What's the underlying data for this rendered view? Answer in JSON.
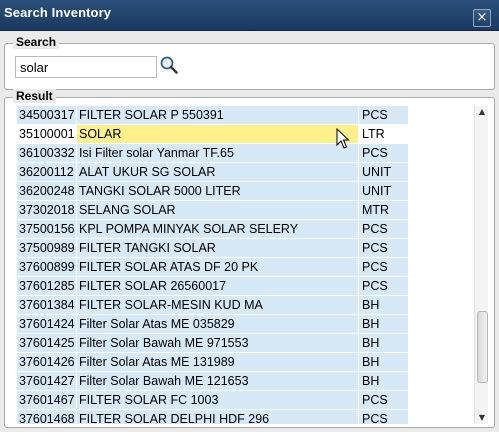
{
  "window": {
    "title": "Search Inventory",
    "close_label": "×"
  },
  "search": {
    "legend": "Search",
    "value": "solar"
  },
  "result": {
    "legend": "Result",
    "rows": [
      {
        "code": "34500317",
        "name": "FILTER SOLAR P 550391",
        "unit": "PCS"
      },
      {
        "code": "35100001",
        "name": "SOLAR",
        "unit": "LTR"
      },
      {
        "code": "36100332",
        "name": "Isi Filter solar Yanmar TF.65",
        "unit": "PCS"
      },
      {
        "code": "36200112",
        "name": "ALAT UKUR SG SOLAR",
        "unit": "UNIT"
      },
      {
        "code": "36200248",
        "name": "TANGKI SOLAR 5000 LITER",
        "unit": "UNIT"
      },
      {
        "code": "37302018",
        "name": "SELANG SOLAR",
        "unit": "MTR"
      },
      {
        "code": "37500156",
        "name": "KPL POMPA MINYAK SOLAR SELERY",
        "unit": "PCS"
      },
      {
        "code": "37500989",
        "name": "FILTER TANGKI SOLAR",
        "unit": "PCS"
      },
      {
        "code": "37600899",
        "name": "FILTER SOLAR ATAS DF 20 PK",
        "unit": "PCS"
      },
      {
        "code": "37601285",
        "name": "FILTER SOLAR 26560017",
        "unit": "PCS"
      },
      {
        "code": "37601384",
        "name": "FILTER SOLAR-MESIN KUD MA",
        "unit": "BH"
      },
      {
        "code": "37601424",
        "name": "Filter Solar Atas ME 035829",
        "unit": "BH"
      },
      {
        "code": "37601425",
        "name": "Filter Solar Bawah ME 971553",
        "unit": "BH"
      },
      {
        "code": "37601426",
        "name": "Filter Solar Atas ME 131989",
        "unit": "BH"
      },
      {
        "code": "37601427",
        "name": "Filter Solar Bawah ME 121653",
        "unit": "BH"
      },
      {
        "code": "37601467",
        "name": "FILTER SOLAR FC 1003",
        "unit": "PCS"
      },
      {
        "code": "37601468",
        "name": "FILTER SOLAR DELPHI HDF 296",
        "unit": "PCS"
      }
    ]
  },
  "scrollbar": {
    "up_glyph": "▲",
    "down_glyph": "▼"
  },
  "colors": {
    "titlebar": "#1f4470",
    "row_stripe": "#d7e8f7",
    "highlight": "#fdf08a"
  }
}
